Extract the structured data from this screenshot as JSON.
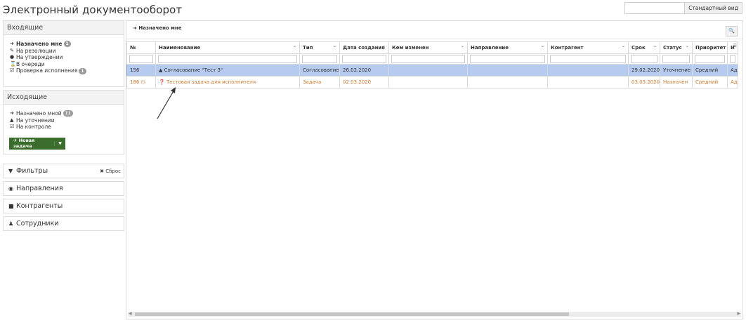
{
  "app": {
    "title": "Электронный документооборот"
  },
  "view_switch": {
    "label": "Стандартный вид"
  },
  "incoming": {
    "title": "Входящие",
    "items": [
      {
        "label": "Назначено мне",
        "badge": "1",
        "icon": "sign-in-icon"
      },
      {
        "label": "На резолюции",
        "badge": "",
        "icon": "edit-icon"
      },
      {
        "label": "На утверждении",
        "badge": "",
        "icon": "check-circle-icon"
      },
      {
        "label": "В очереди",
        "badge": "",
        "icon": "hourglass-icon"
      },
      {
        "label": "Проверка исполнения",
        "badge": "1",
        "icon": "check-square-icon"
      }
    ]
  },
  "outgoing": {
    "title": "Исходящие",
    "items": [
      {
        "label": "Назначено мной",
        "badge": "11",
        "icon": "sign-out-icon"
      },
      {
        "label": "На уточнении",
        "badge": "",
        "icon": "warning-icon"
      },
      {
        "label": "На контроле",
        "badge": "",
        "icon": "check-square-icon"
      }
    ],
    "new_task": "Новая задача"
  },
  "sections": {
    "filters": "Фильтры",
    "reset": "Сброс",
    "directions": "Направления",
    "contractors": "Контрагенты",
    "employees": "Сотрудники"
  },
  "main": {
    "title": "Назначено мне",
    "columns": [
      "№",
      "Наименование",
      "Тип",
      "Дата создания",
      "Кем изменен",
      "Направление",
      "Контрагент",
      "Срок",
      "Статус",
      "Приоритет",
      "И"
    ],
    "rows": [
      {
        "num": "156",
        "name": "Согласование \"Тест 3\"",
        "type": "Согласование",
        "created": "26.02.2020",
        "changed_by": "",
        "direction": "",
        "contractor": "",
        "due": "29.02.2020",
        "status": "Уточнение",
        "priority": "Средний",
        "extra": "Ад"
      },
      {
        "num": "186",
        "name": "Тестовая задача для исполнителя",
        "type": "Задача",
        "created": "02.03.2020",
        "changed_by": "",
        "direction": "",
        "contractor": "",
        "due": "03.03.2020",
        "status": "Назначен",
        "priority": "Средний",
        "extra": "Ад"
      }
    ]
  },
  "colors": {
    "selected_row": "#b6c9ee",
    "overdue_text": "#c7782d",
    "new_task_button": "#3b6e2c"
  }
}
